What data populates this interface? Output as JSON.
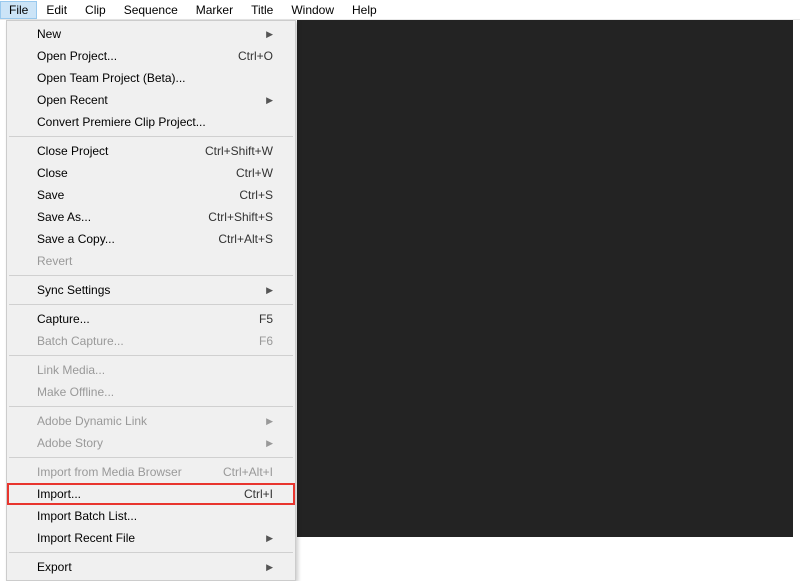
{
  "menubar": {
    "items": [
      "File",
      "Edit",
      "Clip",
      "Sequence",
      "Marker",
      "Title",
      "Window",
      "Help"
    ]
  },
  "dropdown": {
    "groups": [
      [
        {
          "label": "New",
          "shortcut": "",
          "submenu": true,
          "disabled": false
        },
        {
          "label": "Open Project...",
          "shortcut": "Ctrl+O",
          "submenu": false,
          "disabled": false
        },
        {
          "label": "Open Team Project (Beta)...",
          "shortcut": "",
          "submenu": false,
          "disabled": false
        },
        {
          "label": "Open Recent",
          "shortcut": "",
          "submenu": true,
          "disabled": false
        },
        {
          "label": "Convert Premiere Clip Project...",
          "shortcut": "",
          "submenu": false,
          "disabled": false
        }
      ],
      [
        {
          "label": "Close Project",
          "shortcut": "Ctrl+Shift+W",
          "submenu": false,
          "disabled": false
        },
        {
          "label": "Close",
          "shortcut": "Ctrl+W",
          "submenu": false,
          "disabled": false
        },
        {
          "label": "Save",
          "shortcut": "Ctrl+S",
          "submenu": false,
          "disabled": false
        },
        {
          "label": "Save As...",
          "shortcut": "Ctrl+Shift+S",
          "submenu": false,
          "disabled": false
        },
        {
          "label": "Save a Copy...",
          "shortcut": "Ctrl+Alt+S",
          "submenu": false,
          "disabled": false
        },
        {
          "label": "Revert",
          "shortcut": "",
          "submenu": false,
          "disabled": true
        }
      ],
      [
        {
          "label": "Sync Settings",
          "shortcut": "",
          "submenu": true,
          "disabled": false
        }
      ],
      [
        {
          "label": "Capture...",
          "shortcut": "F5",
          "submenu": false,
          "disabled": false
        },
        {
          "label": "Batch Capture...",
          "shortcut": "F6",
          "submenu": false,
          "disabled": true
        }
      ],
      [
        {
          "label": "Link Media...",
          "shortcut": "",
          "submenu": false,
          "disabled": true
        },
        {
          "label": "Make Offline...",
          "shortcut": "",
          "submenu": false,
          "disabled": true
        }
      ],
      [
        {
          "label": "Adobe Dynamic Link",
          "shortcut": "",
          "submenu": true,
          "disabled": true
        },
        {
          "label": "Adobe Story",
          "shortcut": "",
          "submenu": true,
          "disabled": true
        }
      ],
      [
        {
          "label": "Import from Media Browser",
          "shortcut": "Ctrl+Alt+I",
          "submenu": false,
          "disabled": true
        },
        {
          "label": "Import...",
          "shortcut": "Ctrl+I",
          "submenu": false,
          "disabled": false,
          "highlighted": true
        },
        {
          "label": "Import Batch List...",
          "shortcut": "",
          "submenu": false,
          "disabled": false
        },
        {
          "label": "Import Recent File",
          "shortcut": "",
          "submenu": true,
          "disabled": false
        }
      ],
      [
        {
          "label": "Export",
          "shortcut": "",
          "submenu": true,
          "disabled": false
        }
      ]
    ]
  }
}
